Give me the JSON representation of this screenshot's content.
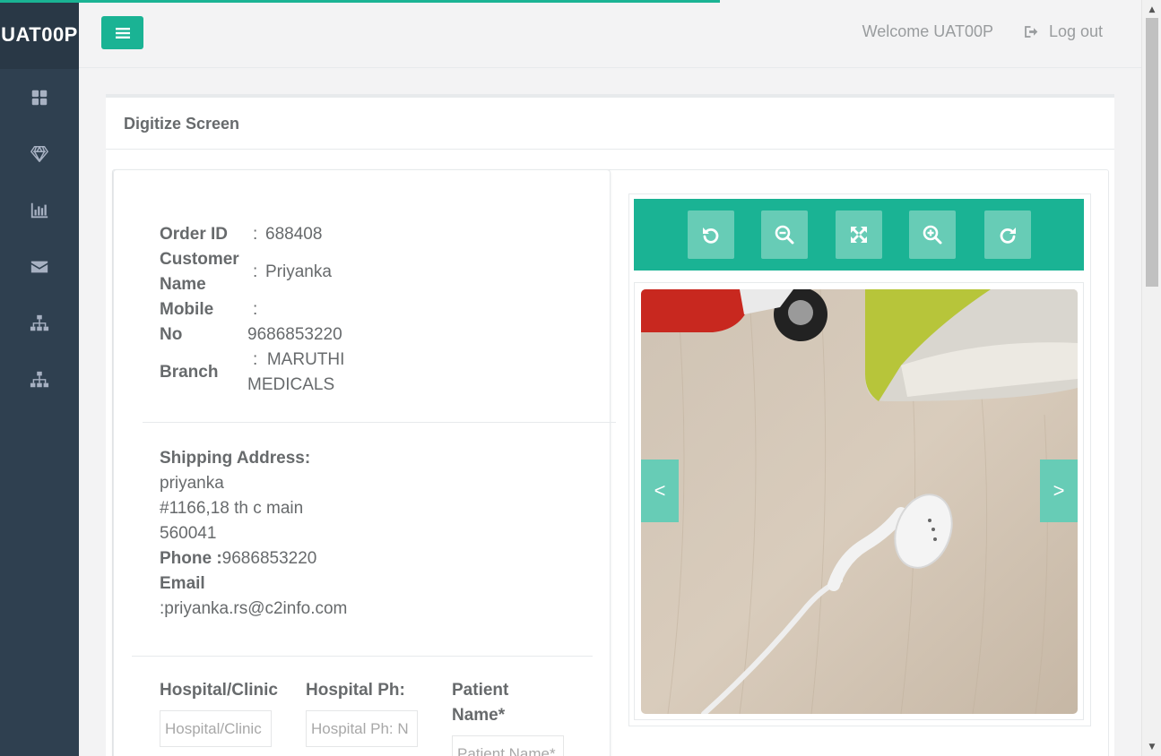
{
  "app": {
    "brand": "UAT00P",
    "progress_fraction": 0.62
  },
  "sidebar": {
    "items": [
      {
        "icon": "dashboard-icon"
      },
      {
        "icon": "diamond-icon"
      },
      {
        "icon": "bar-chart-icon"
      },
      {
        "icon": "envelope-icon"
      },
      {
        "icon": "sitemap-icon"
      },
      {
        "icon": "sitemap-icon"
      }
    ]
  },
  "header": {
    "menu_icon": "hamburger-icon",
    "welcome": "Welcome UAT00P",
    "logout": "Log out"
  },
  "page": {
    "title": "Digitize Screen"
  },
  "order": {
    "order_id_label": "Order ID",
    "order_id": "688408",
    "customer_label_1": "Customer",
    "customer_label_2": "Name",
    "customer": "Priyanka",
    "mobile_label_1": "Mobile",
    "mobile_label_2": "No",
    "mobile": "9686853220",
    "branch_label": "Branch",
    "branch_1": "MARUTHI",
    "branch_2": "MEDICALS",
    "sep": ":"
  },
  "shipping": {
    "heading": "Shipping Address:",
    "name": "priyanka",
    "line1": "#1166,18 th c main",
    "pincode": "560041",
    "phone_label": "Phone :",
    "phone": "9686853220",
    "email_label": "Email",
    "email": ":priyanka.rs@c2info.com"
  },
  "form": {
    "hospital_label": "Hospital/Clinic",
    "hospital_placeholder": "Hospital/Clinic",
    "hospital_ph_label": "Hospital Ph:",
    "hospital_ph_placeholder": "Hospital Ph: N",
    "patient_label_1": "Patient",
    "patient_label_2": "Name*",
    "patient_placeholder": "Patient Name*"
  },
  "viewer": {
    "tools": [
      "rotate-left-icon",
      "zoom-out-icon",
      "fullscreen-icon",
      "zoom-in-icon",
      "rotate-right-icon"
    ],
    "prev": "<",
    "next": ">",
    "accent": "#1ab394",
    "tool_bg": "#67ccb6"
  }
}
